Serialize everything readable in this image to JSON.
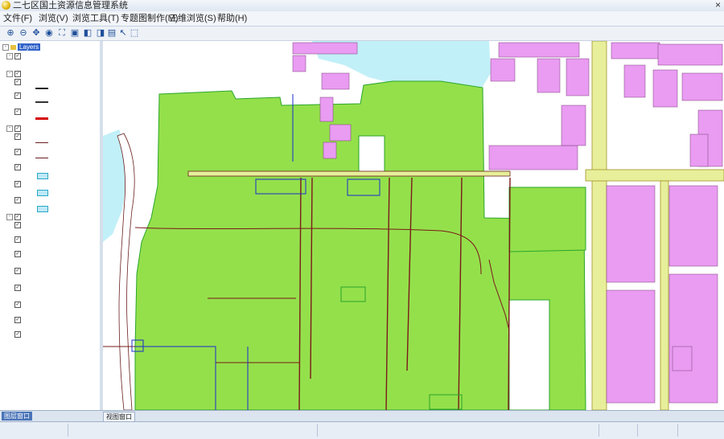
{
  "window": {
    "title": "二七区国土资源信息管理系统"
  },
  "menu": [
    {
      "key": "file",
      "label": "文件(F)"
    },
    {
      "key": "view",
      "label": "浏览(V)"
    },
    {
      "key": "tools",
      "label": "浏览工具(T)"
    },
    {
      "key": "thematic",
      "label": "专题图制作(M)"
    },
    {
      "key": "3d",
      "label": "三维浏览(S)"
    },
    {
      "key": "help",
      "label": "帮助(H)"
    }
  ],
  "layer_tree": {
    "root": "Layers",
    "nodes": [
      {
        "group": "",
        "children": [
          ""
        ]
      },
      {
        "group": "",
        "children": [
          "",
          "",
          ""
        ]
      },
      {
        "group": "",
        "children": [
          "",
          "",
          "",
          "",
          ""
        ]
      },
      {
        "group": "",
        "children": [
          "",
          "",
          "",
          "",
          "",
          "",
          "",
          ""
        ]
      }
    ],
    "colors": {
      "road_main": "#d40000",
      "road_minor": "#6a1e1e",
      "water": "#bfe9f7",
      "water_outline": "#2aa8c8",
      "fill": "#2ab52a"
    }
  },
  "bottom_tabs": {
    "layer_tab": "图层窗口",
    "results_tab": "",
    "map_tab": "视图窗口"
  },
  "status": {
    "left": "",
    "coords": "",
    "scale_label": "",
    "scale_value": "",
    "user_label": "",
    "user_value": ""
  },
  "map_labels": {
    "land": "",
    "house": "",
    "tree": ""
  },
  "map_colors": {
    "farmland": "#94e04b",
    "building": "#e99cf2",
    "road": "#e7ef9a",
    "water": "#c2f0f8",
    "parcel_line": "#7a1a1a",
    "boundary_blue": "#1c2ccc",
    "boundary_green": "#2aa52a",
    "background": "#ffffff"
  }
}
